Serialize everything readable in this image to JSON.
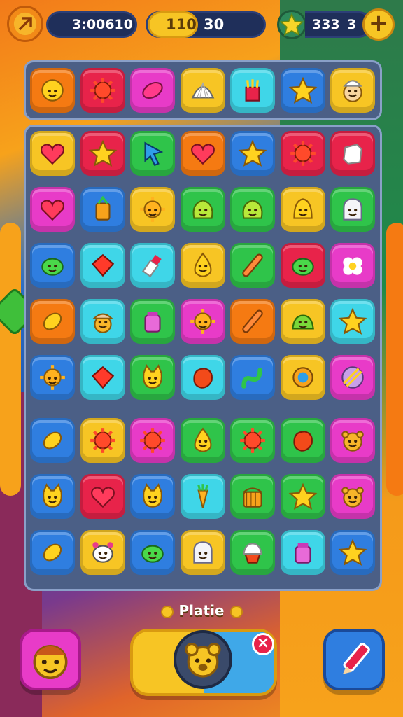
{
  "hud": {
    "timer_value": "3:00610",
    "score_value": "110",
    "score_extra": "30",
    "gems_value": "333",
    "gems_extra": "3",
    "add_label": "+"
  },
  "bottom": {
    "label": "Platie",
    "close_label": "×"
  },
  "colors": {
    "yellow": "#f7c524",
    "red": "#e8234a",
    "magenta": "#e83bc8",
    "cyan": "#3fd6e8",
    "blue": "#2f7ee0",
    "green": "#2fc44a",
    "orange": "#f57a12",
    "board": "#4b5f86"
  },
  "top_row": [
    {
      "bg": "orange",
      "icon": "smiley-face-icon"
    },
    {
      "bg": "red",
      "icon": "spiky-ball-icon"
    },
    {
      "bg": "magenta",
      "icon": "jelly-bean-icon"
    },
    {
      "bg": "yellow",
      "icon": "shell-icon"
    },
    {
      "bg": "cyan",
      "icon": "fries-icon"
    },
    {
      "bg": "blue",
      "icon": "star-icon"
    },
    {
      "bg": "yellow",
      "icon": "chef-face-icon"
    }
  ],
  "grid": [
    [
      {
        "bg": "yellow",
        "icon": "heart-icon"
      },
      {
        "bg": "red",
        "icon": "star-icon"
      },
      {
        "bg": "green",
        "icon": "cursor-icon"
      },
      {
        "bg": "orange",
        "icon": "heart-icon"
      },
      {
        "bg": "blue",
        "icon": "star-icon"
      },
      {
        "bg": "red",
        "icon": "spiky-ball-icon"
      },
      {
        "bg": "red",
        "icon": "sugar-cube-icon"
      }
    ],
    [
      {
        "bg": "magenta",
        "icon": "heart-icon"
      },
      {
        "bg": "blue",
        "icon": "bag-icon"
      },
      {
        "bg": "yellow",
        "icon": "sun-face-icon"
      },
      {
        "bg": "green",
        "icon": "blob-face-icon"
      },
      {
        "bg": "green",
        "icon": "blob-face-icon"
      },
      {
        "bg": "yellow",
        "icon": "bell-face-icon"
      },
      {
        "bg": "green",
        "icon": "ghost-face-icon"
      }
    ],
    [
      {
        "bg": "blue",
        "icon": "frog-face-icon"
      },
      {
        "bg": "cyan",
        "icon": "red-gem-icon"
      },
      {
        "bg": "cyan",
        "icon": "lipstick-icon"
      },
      {
        "bg": "yellow",
        "icon": "drop-face-icon"
      },
      {
        "bg": "green",
        "icon": "candy-stick-icon"
      },
      {
        "bg": "red",
        "icon": "frog-face-icon"
      },
      {
        "bg": "magenta",
        "icon": "flower-icon"
      }
    ],
    [
      {
        "bg": "orange",
        "icon": "lemon-icon"
      },
      {
        "bg": "cyan",
        "icon": "hat-face-icon"
      },
      {
        "bg": "green",
        "icon": "jar-icon"
      },
      {
        "bg": "magenta",
        "icon": "sun-face-icon"
      },
      {
        "bg": "orange",
        "icon": "candy-stick-icon"
      },
      {
        "bg": "yellow",
        "icon": "slime-icon"
      },
      {
        "bg": "cyan",
        "icon": "star-icon"
      }
    ],
    [
      {
        "bg": "blue",
        "icon": "sun-face-icon"
      },
      {
        "bg": "cyan",
        "icon": "red-gem-icon"
      },
      {
        "bg": "green",
        "icon": "cat-face-icon"
      },
      {
        "bg": "cyan",
        "icon": "red-blob-icon"
      },
      {
        "bg": "blue",
        "icon": "worm-icon"
      },
      {
        "bg": "yellow",
        "icon": "orb-icon"
      },
      {
        "bg": "magenta",
        "icon": "striped-ball-icon"
      }
    ],
    [
      {
        "bg": "blue",
        "icon": "lemon-icon"
      },
      {
        "bg": "yellow",
        "icon": "spiky-ball-icon"
      },
      {
        "bg": "magenta",
        "icon": "spiky-ball-icon"
      },
      {
        "bg": "green",
        "icon": "drop-face-icon"
      },
      {
        "bg": "green",
        "icon": "spiky-ball-icon"
      },
      {
        "bg": "green",
        "icon": "red-blob-icon"
      },
      {
        "bg": "magenta",
        "icon": "bear-face-icon"
      }
    ],
    [
      {
        "bg": "blue",
        "icon": "cat-face-icon"
      },
      {
        "bg": "red",
        "icon": "heart-icon"
      },
      {
        "bg": "blue",
        "icon": "cat-face-icon"
      },
      {
        "bg": "cyan",
        "icon": "carrot-icon"
      },
      {
        "bg": "green",
        "icon": "basket-icon"
      },
      {
        "bg": "green",
        "icon": "star-icon"
      },
      {
        "bg": "magenta",
        "icon": "bear-face-icon"
      }
    ],
    [
      {
        "bg": "blue",
        "icon": "lemon-icon"
      },
      {
        "bg": "yellow",
        "icon": "cow-face-icon"
      },
      {
        "bg": "blue",
        "icon": "frog-face-icon"
      },
      {
        "bg": "yellow",
        "icon": "ghost-face-icon"
      },
      {
        "bg": "green",
        "icon": "cupcake-icon"
      },
      {
        "bg": "cyan",
        "icon": "jar-icon"
      },
      {
        "bg": "blue",
        "icon": "star-icon"
      }
    ]
  ]
}
